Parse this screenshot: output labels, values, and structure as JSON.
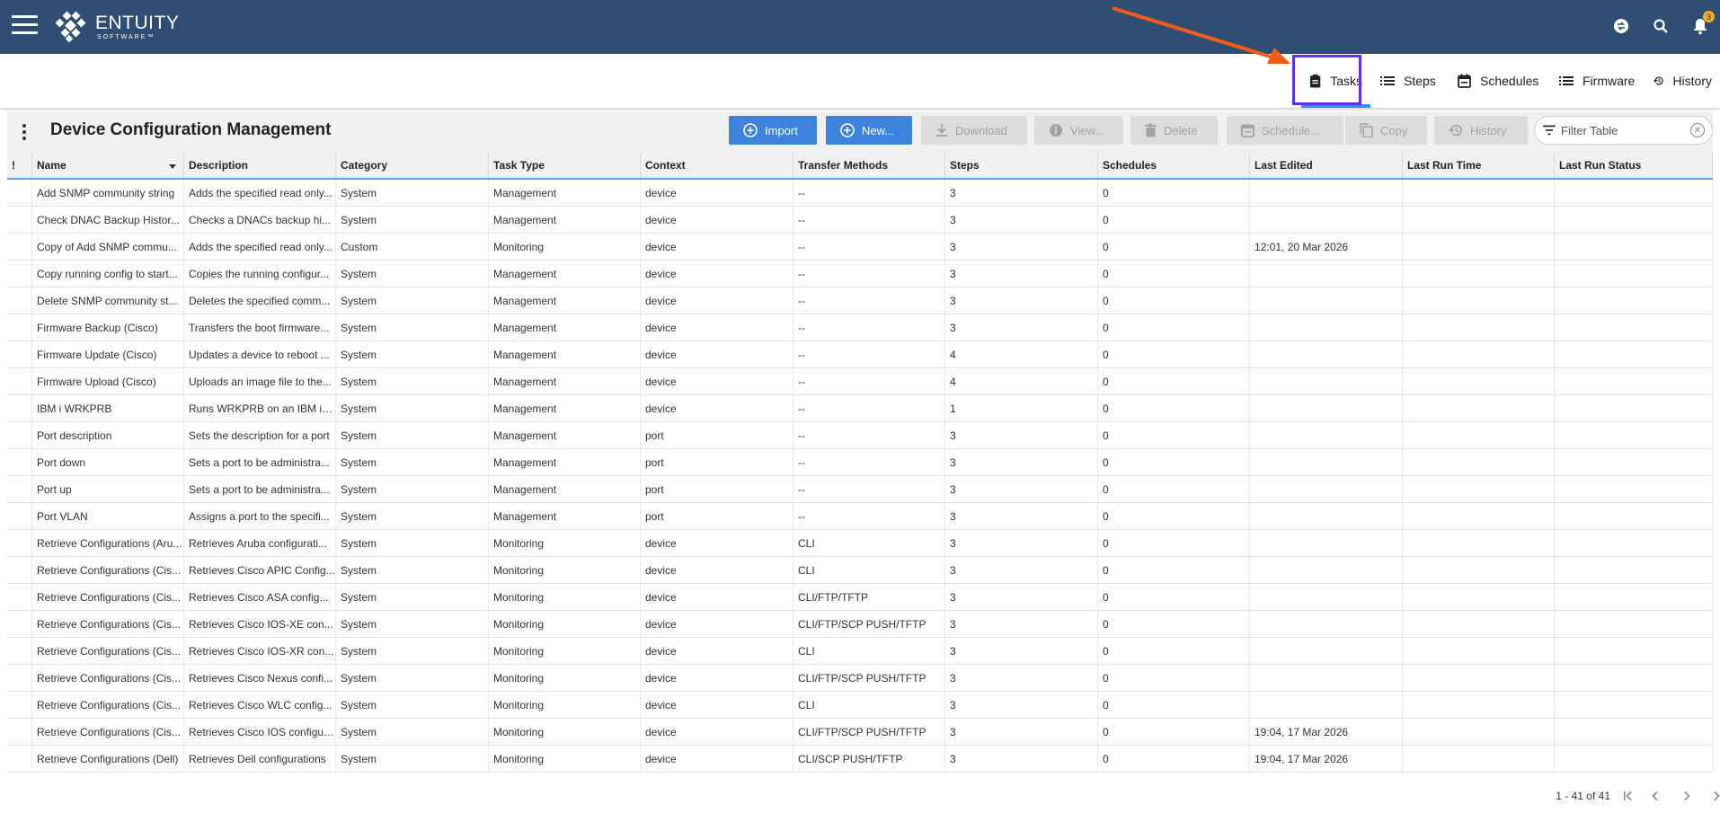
{
  "app": {
    "brand_name": "ENTUITY",
    "brand_sub": "SOFTWARE™",
    "notification_count": "3",
    "colors": {
      "appbar": "#2f4e73",
      "primary_button": "#3d83de",
      "active_tab_underline": "#2196f3",
      "annotation_box": "#5f2ef0",
      "annotation_arrow": "#f25c18"
    }
  },
  "subnav": {
    "tabs": [
      {
        "label": "Tasks",
        "icon": "clipboard-icon",
        "active": true
      },
      {
        "label": "Steps",
        "icon": "list-icon"
      },
      {
        "label": "Schedules",
        "icon": "calendar-icon"
      },
      {
        "label": "Firmware",
        "icon": "list-icon"
      },
      {
        "label": "History",
        "icon": "history-icon"
      }
    ]
  },
  "page": {
    "title": "Device Configuration Management",
    "buttons": {
      "import": "Import",
      "new": "New...",
      "download": "Download",
      "view": "View...",
      "delete": "Delete",
      "schedule": "Schedule...",
      "copy": "Copy",
      "history": "History"
    },
    "filter_placeholder": "Filter Table"
  },
  "table": {
    "columns": [
      "!",
      "Name",
      "Description",
      "Category",
      "Task Type",
      "Context",
      "Transfer Methods",
      "Steps",
      "Schedules",
      "Last Edited",
      "Last Run Time",
      "Last Run Status"
    ],
    "rows": [
      [
        "",
        "Add SNMP community string",
        "Adds the specified read only...",
        "System",
        "Management",
        "device",
        "--",
        "3",
        "0",
        "",
        "",
        ""
      ],
      [
        "",
        "Check DNAC Backup Histor...",
        "Checks a DNACs backup hi...",
        "System",
        "Management",
        "device",
        "--",
        "3",
        "0",
        "",
        "",
        ""
      ],
      [
        "",
        "Copy of Add SNMP commu...",
        "Adds the specified read only...",
        "Custom",
        "Monitoring",
        "device",
        "--",
        "3",
        "0",
        "12:01, 20 Mar 2026",
        "",
        ""
      ],
      [
        "",
        "Copy running config to start...",
        "Copies the running configur...",
        "System",
        "Management",
        "device",
        "--",
        "3",
        "0",
        "",
        "",
        ""
      ],
      [
        "",
        "Delete SNMP community st...",
        "Deletes the specified comm...",
        "System",
        "Management",
        "device",
        "--",
        "3",
        "0",
        "",
        "",
        ""
      ],
      [
        "",
        "Firmware Backup (Cisco)",
        "Transfers the boot firmware...",
        "System",
        "Management",
        "device",
        "--",
        "3",
        "0",
        "",
        "",
        ""
      ],
      [
        "",
        "Firmware Update (Cisco)",
        "Updates a device to reboot ...",
        "System",
        "Management",
        "device",
        "--",
        "4",
        "0",
        "",
        "",
        ""
      ],
      [
        "",
        "Firmware Upload (Cisco)",
        "Uploads an image file to the...",
        "System",
        "Management",
        "device",
        "--",
        "4",
        "0",
        "",
        "",
        ""
      ],
      [
        "",
        "IBM i WRKPRB",
        "Runs WRKPRB on an IBM i d...",
        "System",
        "Management",
        "device",
        "--",
        "1",
        "0",
        "",
        "",
        ""
      ],
      [
        "",
        "Port description",
        "Sets the description for a port",
        "System",
        "Management",
        "port",
        "--",
        "3",
        "0",
        "",
        "",
        ""
      ],
      [
        "",
        "Port down",
        "Sets a port to be administra...",
        "System",
        "Management",
        "port",
        "--",
        "3",
        "0",
        "",
        "",
        ""
      ],
      [
        "",
        "Port up",
        "Sets a port to be administra...",
        "System",
        "Management",
        "port",
        "--",
        "3",
        "0",
        "",
        "",
        ""
      ],
      [
        "",
        "Port VLAN",
        "Assigns a port to the specifi...",
        "System",
        "Management",
        "port",
        "--",
        "3",
        "0",
        "",
        "",
        ""
      ],
      [
        "",
        "Retrieve Configurations (Aru...",
        "Retrieves Aruba configurati...",
        "System",
        "Monitoring",
        "device",
        "CLI",
        "3",
        "0",
        "",
        "",
        ""
      ],
      [
        "",
        "Retrieve Configurations (Cis...",
        "Retrieves Cisco APIC Config...",
        "System",
        "Monitoring",
        "device",
        "CLI",
        "3",
        "0",
        "",
        "",
        ""
      ],
      [
        "",
        "Retrieve Configurations (Cis...",
        "Retrieves Cisco ASA config...",
        "System",
        "Monitoring",
        "device",
        "CLI/FTP/TFTP",
        "3",
        "0",
        "",
        "",
        ""
      ],
      [
        "",
        "Retrieve Configurations (Cis...",
        "Retrieves Cisco IOS-XE con...",
        "System",
        "Monitoring",
        "device",
        "CLI/FTP/SCP PUSH/TFTP",
        "3",
        "0",
        "",
        "",
        ""
      ],
      [
        "",
        "Retrieve Configurations (Cis...",
        "Retrieves Cisco IOS-XR con...",
        "System",
        "Monitoring",
        "device",
        "CLI",
        "3",
        "0",
        "",
        "",
        ""
      ],
      [
        "",
        "Retrieve Configurations (Cis...",
        "Retrieves Cisco Nexus confi...",
        "System",
        "Monitoring",
        "device",
        "CLI/FTP/SCP PUSH/TFTP",
        "3",
        "0",
        "",
        "",
        ""
      ],
      [
        "",
        "Retrieve Configurations (Cis...",
        "Retrieves Cisco WLC config...",
        "System",
        "Monitoring",
        "device",
        "CLI",
        "3",
        "0",
        "",
        "",
        ""
      ],
      [
        "",
        "Retrieve Configurations (Cis...",
        "Retrieves Cisco IOS configur...",
        "System",
        "Monitoring",
        "device",
        "CLI/FTP/SCP PUSH/TFTP",
        "3",
        "0",
        "19:04, 17 Mar 2026",
        "",
        ""
      ],
      [
        "",
        "Retrieve Configurations (Dell)",
        "Retrieves Dell configurations",
        "System",
        "Monitoring",
        "device",
        "CLI/SCP PUSH/TFTP",
        "3",
        "0",
        "19:04, 17 Mar 2026",
        "",
        ""
      ]
    ]
  },
  "pagination": {
    "range_text": "1 - 41 of 41"
  }
}
